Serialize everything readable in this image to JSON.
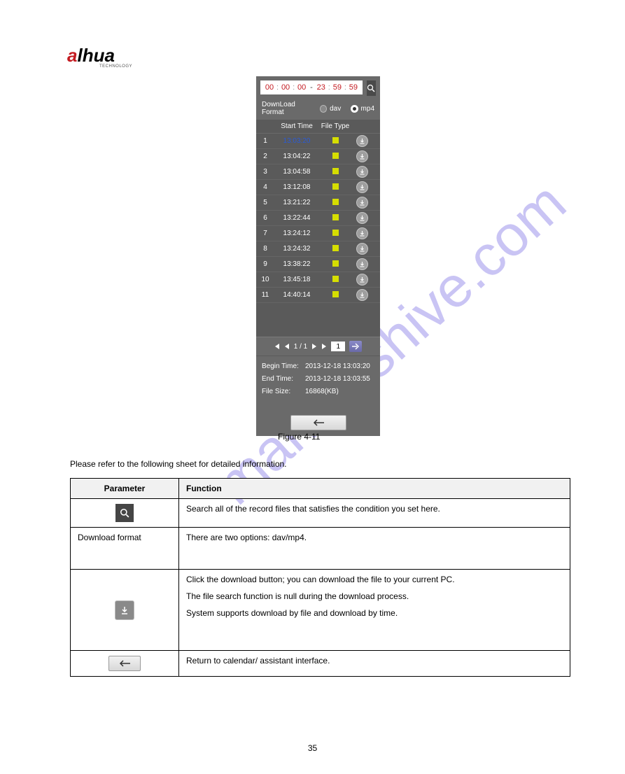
{
  "logo": {
    "text1": "a",
    "text2": "lhua",
    "sub": "TECHNOLOGY"
  },
  "panel": {
    "time_from": {
      "h": "00",
      "m": "00",
      "s": "00"
    },
    "time_to": {
      "h": "23",
      "m": "59",
      "s": "59"
    },
    "format_label": "DownLoad Format",
    "format_dav": "dav",
    "format_mp4": "mp4",
    "header_start": "Start Time",
    "header_filetype": "File Type",
    "rows": [
      {
        "idx": "1",
        "start": "13:03:20",
        "selected": true
      },
      {
        "idx": "2",
        "start": "13:04:22",
        "selected": false
      },
      {
        "idx": "3",
        "start": "13:04:58",
        "selected": false
      },
      {
        "idx": "4",
        "start": "13:12:08",
        "selected": false
      },
      {
        "idx": "5",
        "start": "13:21:22",
        "selected": false
      },
      {
        "idx": "6",
        "start": "13:22:44",
        "selected": false
      },
      {
        "idx": "7",
        "start": "13:24:12",
        "selected": false
      },
      {
        "idx": "8",
        "start": "13:24:32",
        "selected": false
      },
      {
        "idx": "9",
        "start": "13:38:22",
        "selected": false
      },
      {
        "idx": "10",
        "start": "13:45:18",
        "selected": false
      },
      {
        "idx": "11",
        "start": "14:40:14",
        "selected": false
      }
    ],
    "pager": {
      "current": "1 / 1",
      "input": "1"
    },
    "meta": {
      "begin_label": "Begin Time:",
      "begin_value": "2013-12-18 13:03:20",
      "end_label": "End Time:",
      "end_value": "2013-12-18 13:03:55",
      "size_label": "File Size:",
      "size_value": "16868(KB)"
    }
  },
  "figure_caption": "Figure 4-11",
  "refer_caption": "Please refer to the following sheet for detailed information.",
  "param_table": {
    "h1": "Parameter",
    "h2": "Function",
    "r1c2": "Search all of the record files that satisfies the condition you set here.",
    "r2c1": "Download format",
    "r2c2": "There are two options: dav/mp4.",
    "r3c2a": "Click the download button; you can download the file to your current PC.",
    "r3c2b": "The file search function is null during the download process.",
    "r3c2c": "System supports download by file and download by time.",
    "r4c2": "Return to calendar/ assistant interface."
  },
  "watermark": "manualshive.com",
  "page_number": "35"
}
